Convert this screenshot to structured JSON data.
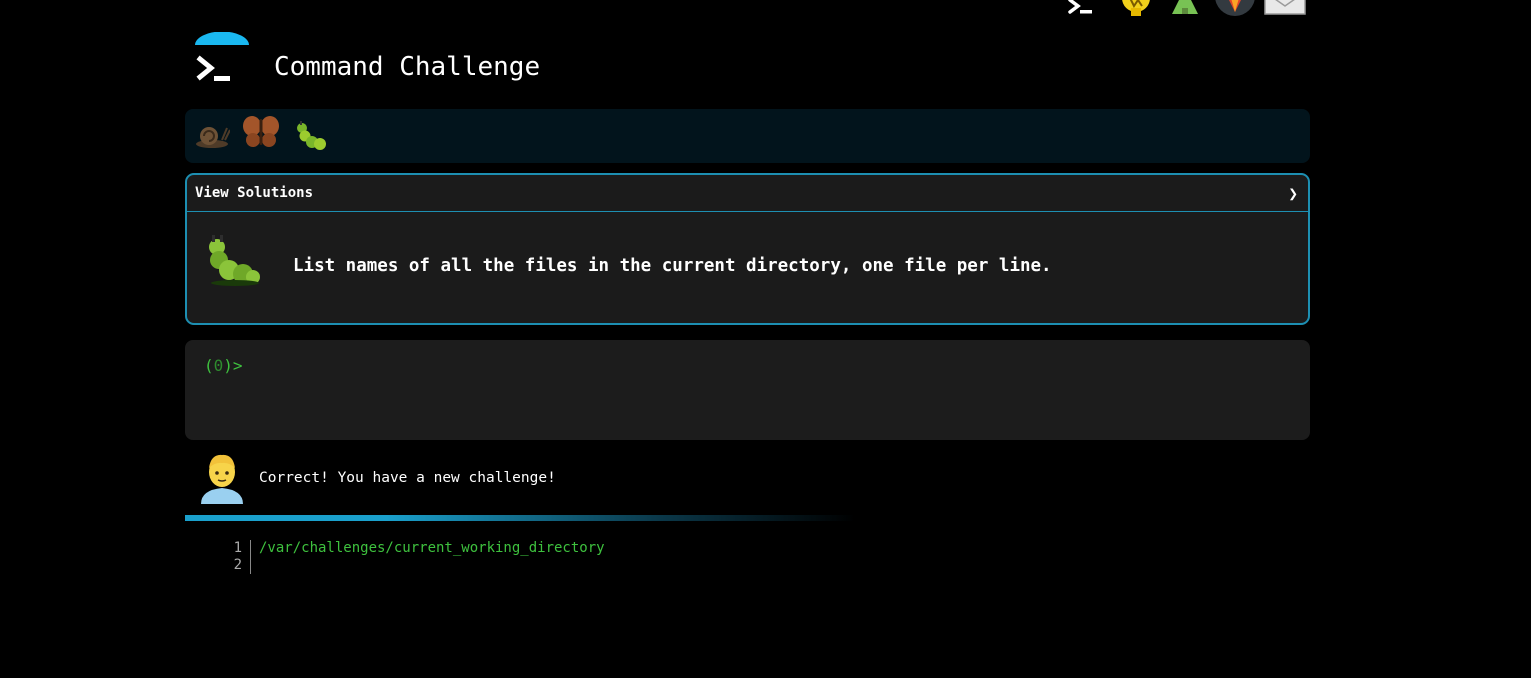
{
  "header": {
    "title": "Command Challenge",
    "logo_icon": "terminal-prompt-icon",
    "logo_color": "#1ab8f0"
  },
  "top_icons": [
    "terminal-icon",
    "lightbulb-icon",
    "tree-icon",
    "gitlab-icon",
    "mail-icon"
  ],
  "progress": {
    "icons": [
      "snail-icon",
      "butterfly-icon",
      "caterpillar-icon"
    ]
  },
  "challenge": {
    "solutions_label": "View Solutions",
    "chevron": "❯",
    "icon": "caterpillar-icon",
    "text": "List names of all the files in the current directory, one file per line.",
    "border_color": "#1d8fb2"
  },
  "terminal": {
    "prompt_open": "(",
    "prompt_count": "0",
    "prompt_close": ")>",
    "input_value": "",
    "prompt_color": "#3ec13e"
  },
  "feedback": {
    "avatar": "man-technologist-icon",
    "message": "Correct! You have a new challenge!"
  },
  "output": {
    "line_numbers": [
      "1",
      "2"
    ],
    "lines": [
      "/var/challenges/current_working_directory",
      ""
    ]
  }
}
